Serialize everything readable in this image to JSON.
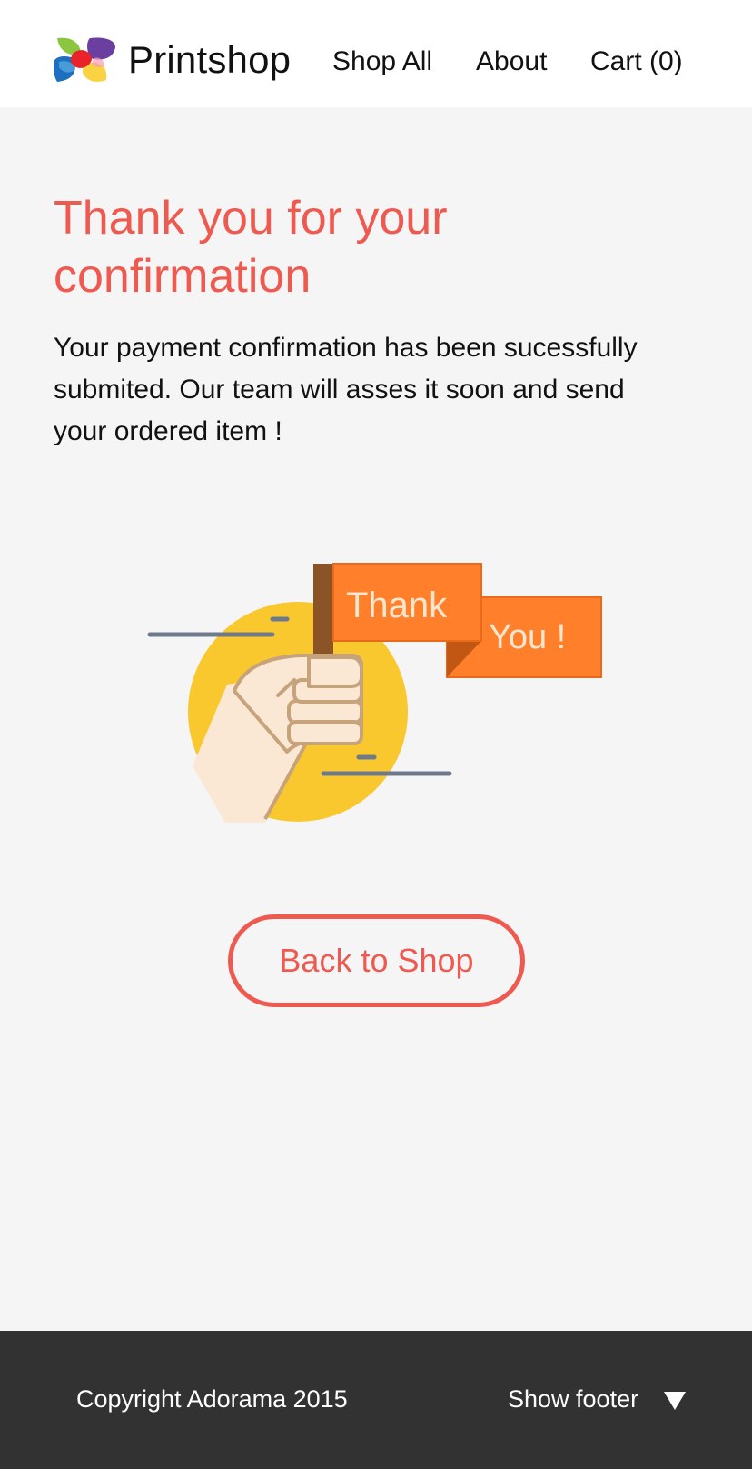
{
  "header": {
    "logo_name": "printshop-logo",
    "brand": "Printshop",
    "nav": {
      "shop_all": "Shop All",
      "about": "About",
      "cart": "Cart (0)"
    }
  },
  "main": {
    "title": "Thank you for your confirmation",
    "message": "Your payment confirmation has been sucessfully submited. Our team will asses it soon and send your ordered item !",
    "illustration": {
      "flag_word_1": "Thank",
      "flag_word_2": "You !",
      "icon": "hand-holding-flag-icon"
    },
    "back_button": "Back to Shop"
  },
  "footer": {
    "copyright": "Copyright Adorama 2015",
    "show_footer": "Show footer",
    "toggle_icon": "triangle-down-icon"
  },
  "colors": {
    "accent": "#ef5a50",
    "flag_orange": "#ff7f2a",
    "circle_yellow": "#f9c82f",
    "footer_bg": "#323232",
    "page_bg": "#f5f5f5"
  }
}
